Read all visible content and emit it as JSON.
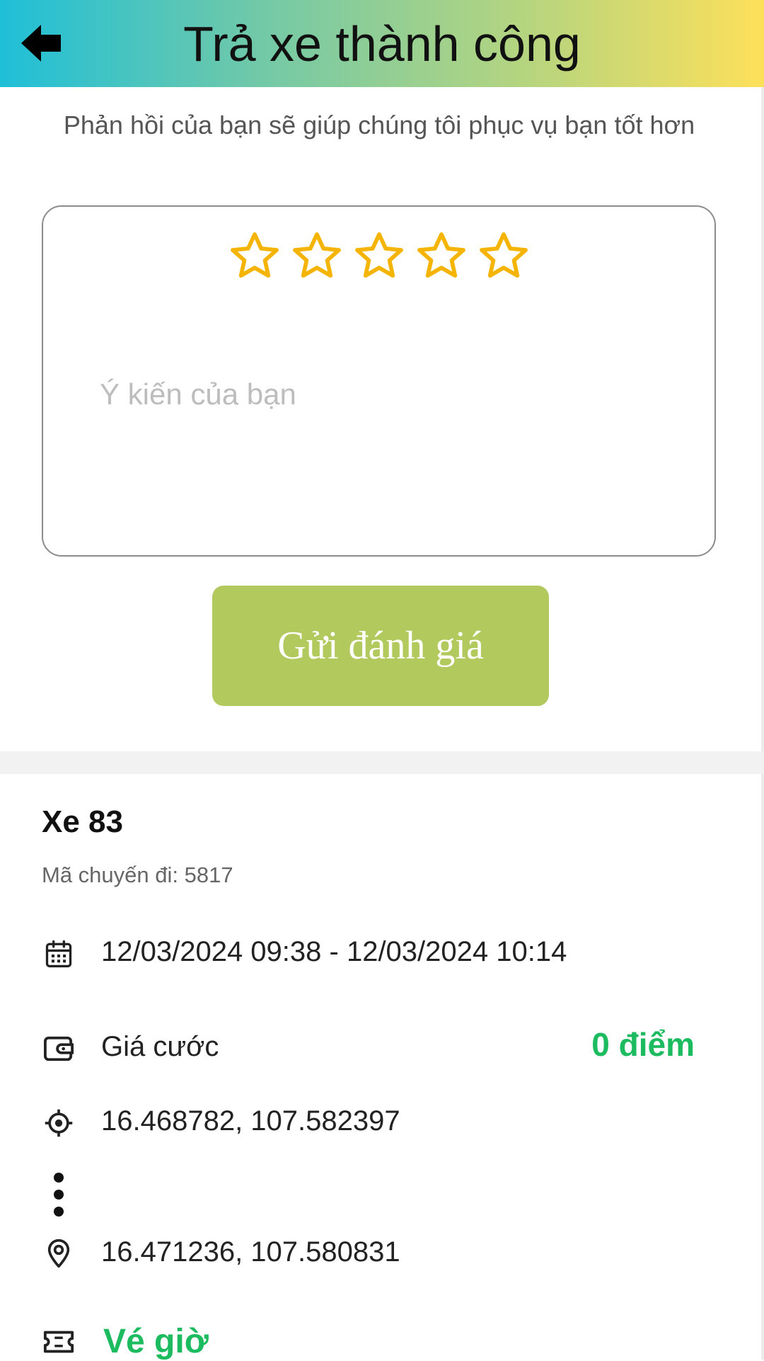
{
  "header": {
    "title": "Trả xe thành công",
    "back_icon": "arrow-left-icon"
  },
  "feedback": {
    "hint": "Phản hồi của bạn sẽ giúp chúng tôi phục vụ bạn tốt hơn",
    "rating": 0,
    "max_rating": 5,
    "star_color": "#f5b400",
    "comment_placeholder": "Ý kiến của bạn",
    "comment_value": "",
    "submit_label": "Gửi đánh giá",
    "submit_color": "#b2c95e"
  },
  "trip": {
    "vehicle": "Xe 83",
    "code": "Mã chuyến đi: 5817",
    "time_range": "12/03/2024 09:38  - 12/03/2024 10:14",
    "fare_label": "Giá cước",
    "fare_value": "0 điểm",
    "start_location": "16.468782, 107.582397",
    "end_location": "16.471236, 107.580831",
    "ticket_type": "Vé giờ",
    "accent_color": "#1dbb5f"
  }
}
